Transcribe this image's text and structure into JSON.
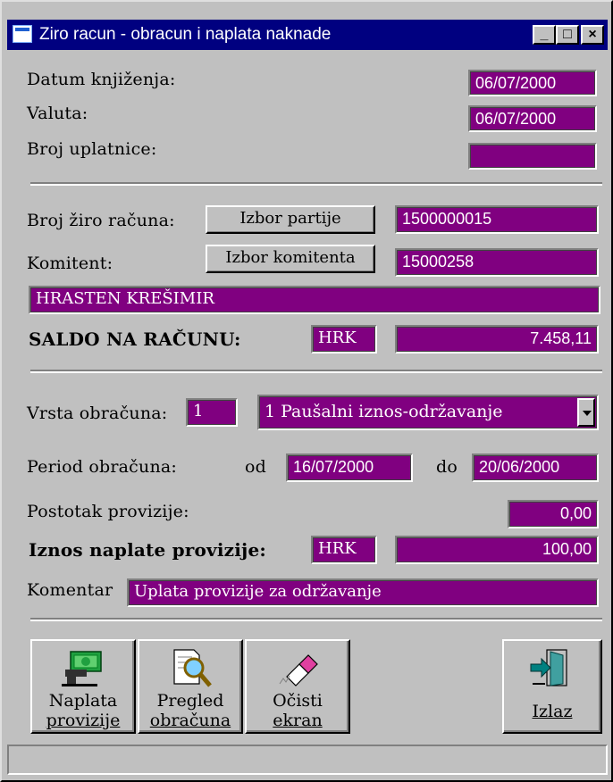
{
  "window": {
    "title": "Ziro racun - obracun i naplata naknade"
  },
  "titlebar_buttons": {
    "minimize": "_",
    "maximize": "□",
    "close": "×"
  },
  "header": {
    "datum_label": "Datum knjiženja:",
    "datum_value": "06/07/2000",
    "valuta_label": "Valuta:",
    "valuta_value": "06/07/2000",
    "uplatnica_label": "Broj uplatnice:",
    "uplatnica_value": ""
  },
  "account": {
    "broj_label": "Broj žiro računa:",
    "izbor_partije_button": "Izbor partije",
    "broj_value": "1500000015",
    "komitent_label": "Komitent:",
    "izbor_komitenta_button": "Izbor komitenta",
    "komitent_value": "15000258",
    "name_value": "HRASTEN KREŠIMIR",
    "saldo_label": "SALDO NA RAČUNU:",
    "saldo_currency": "HRK",
    "saldo_value": "7.458,11"
  },
  "obracun": {
    "vrsta_label": "Vrsta obračuna:",
    "vrsta_code": "1",
    "vrsta_selected": "1  Paušalni iznos-održavanje",
    "period_label": "Period obračuna:",
    "od_label": "od",
    "od_value": "16/07/2000",
    "do_label": "do",
    "do_value": "20/06/2000",
    "postotak_label": "Postotak provizije:",
    "postotak_value": "0,00",
    "iznos_label": "Iznos naplate provizije:",
    "iznos_currency": "HRK",
    "iznos_value": "100,00",
    "komentar_label": "Komentar",
    "komentar_value": "Uplata provizije za održavanje"
  },
  "toolbar": {
    "naplata_line1": "Naplata",
    "naplata_line2": "provizije",
    "pregled_line1": "Pregled",
    "pregled_line2": "obračuna",
    "ocisti_line1": "Očisti",
    "ocisti_line2": "ekran",
    "izlaz": "Izlaz"
  },
  "statusbar": {
    "text": ""
  },
  "colors": {
    "field_bg": "#800080",
    "title_bg": "#000080",
    "window_bg": "#c0c0c0"
  }
}
